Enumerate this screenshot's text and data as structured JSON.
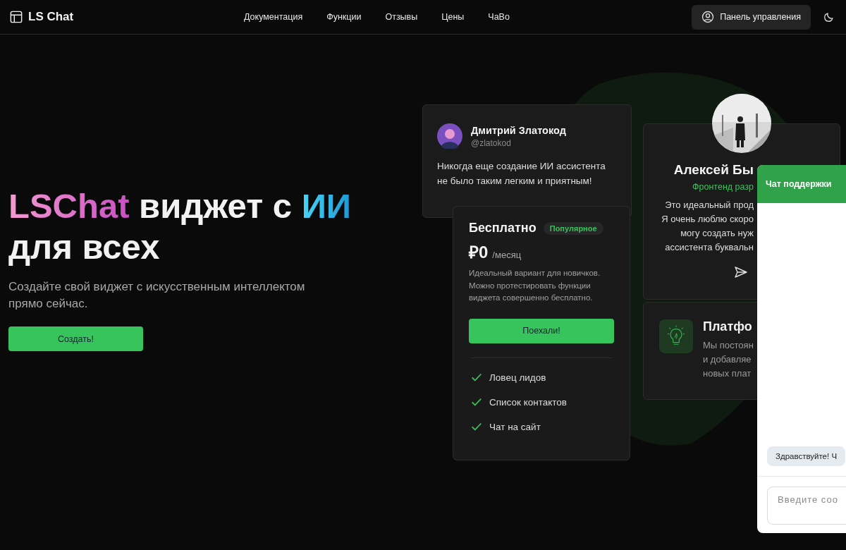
{
  "nav": {
    "brand": "LS Chat",
    "links": [
      "Документация",
      "Функции",
      "Отзывы",
      "Цены",
      "ЧаВо"
    ],
    "dashboard_button": "Панель управления"
  },
  "hero": {
    "title": [
      {
        "text": "LSChat",
        "kind": "pink"
      },
      {
        "text": " виджет с ",
        "kind": "plain"
      },
      {
        "text": "ИИ",
        "kind": "blue"
      },
      {
        "text": " для всех",
        "kind": "plain"
      }
    ],
    "subtitle": "Создайте свой виджет с искусственным интеллектом прямо сейчас.",
    "button": "Создать!"
  },
  "review": {
    "name": "Дмитрий Златокод",
    "handle": "@zlatokod",
    "text": "Никогда еще создание ИИ ассистента не было таким легким и приятным!"
  },
  "pricing": {
    "plan": "Бесплатно",
    "badge": "Популярное",
    "price": "₽0",
    "period": "/месяц",
    "description": "Идеальный вариант для новичков. Можно протестировать функции виджета совершенно бесплатно.",
    "button": "Поехали!",
    "features": [
      {
        "label": "Ловец лидов",
        "checked": true
      },
      {
        "label": "Список контактов",
        "checked": true
      },
      {
        "label": "Чат на сайт",
        "checked": true
      }
    ]
  },
  "review_2": {
    "avatar": {
      "kind": "picture"
    },
    "name": "Алексей Бы",
    "role": "Фронтенд разр",
    "lines": [
      "Это идеальный прод",
      "Я очень люблю скоро",
      "могу создать нуж",
      "ассистента буквальн"
    ]
  },
  "feature_card": {
    "title": "Платфо",
    "lines": [
      "Мы постоян",
      "и добавляе",
      "новых плат"
    ]
  },
  "chat": {
    "title": "Чат поддержки",
    "messages": [
      "Здравствуйте! Ч"
    ],
    "placeholder": "Введите соо"
  }
}
